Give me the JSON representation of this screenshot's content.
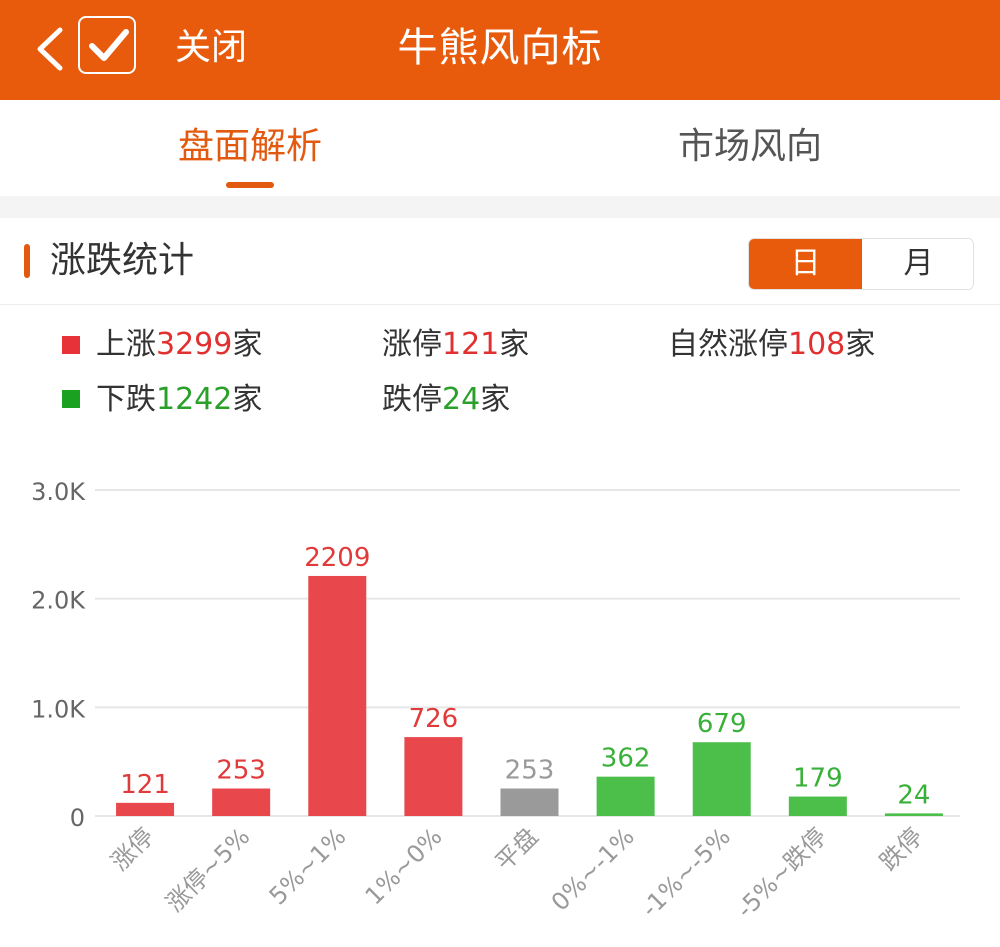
{
  "header": {
    "close_label": "关闭",
    "title": "牛熊风向标",
    "bg_color": "#e85b0c"
  },
  "tabs": [
    {
      "label": "盘面解析",
      "active": true
    },
    {
      "label": "市场风向",
      "active": false
    }
  ],
  "section": {
    "title": "涨跌统计",
    "toggle": [
      {
        "label": "日",
        "active": true
      },
      {
        "label": "月",
        "active": false
      }
    ]
  },
  "stats": {
    "rise": {
      "prefix": "上涨",
      "value": "3299",
      "suffix": "家"
    },
    "limit_up": {
      "prefix": "涨停",
      "value": "121",
      "suffix": "家"
    },
    "natural_limit_up": {
      "prefix": "自然涨停",
      "value": "108",
      "suffix": "家"
    },
    "fall": {
      "prefix": "下跌",
      "value": "1242",
      "suffix": "家"
    },
    "limit_down": {
      "prefix": "跌停",
      "value": "24",
      "suffix": "家"
    }
  },
  "chart_data": {
    "type": "bar",
    "categories": [
      "涨停",
      "涨停~5%",
      "5%~1%",
      "1%~0%",
      "平盘",
      "0%~-1%",
      "-1%~-5%",
      "-5%~跌停",
      "跌停"
    ],
    "values": [
      121,
      253,
      2209,
      726,
      253,
      362,
      679,
      179,
      24
    ],
    "value_labels": [
      "121",
      "253",
      "2209",
      "726",
      "253",
      "362",
      "679",
      "179",
      "24"
    ],
    "colors": [
      "#e8474c",
      "#e8474c",
      "#e8474c",
      "#e8474c",
      "#9a9a9a",
      "#4cbf4a",
      "#4cbf4a",
      "#4cbf4a",
      "#4cbf4a"
    ],
    "label_colors": [
      "#e03a3a",
      "#e03a3a",
      "#e03a3a",
      "#e03a3a",
      "#9a9a9a",
      "#39b039",
      "#39b039",
      "#39b039",
      "#39b039"
    ],
    "y_ticks": [
      0,
      1000,
      2000,
      3000
    ],
    "y_tick_labels": [
      "0",
      "1.0K",
      "2.0K",
      "3.0K"
    ],
    "ylim": [
      0,
      3000
    ],
    "grid": true
  }
}
